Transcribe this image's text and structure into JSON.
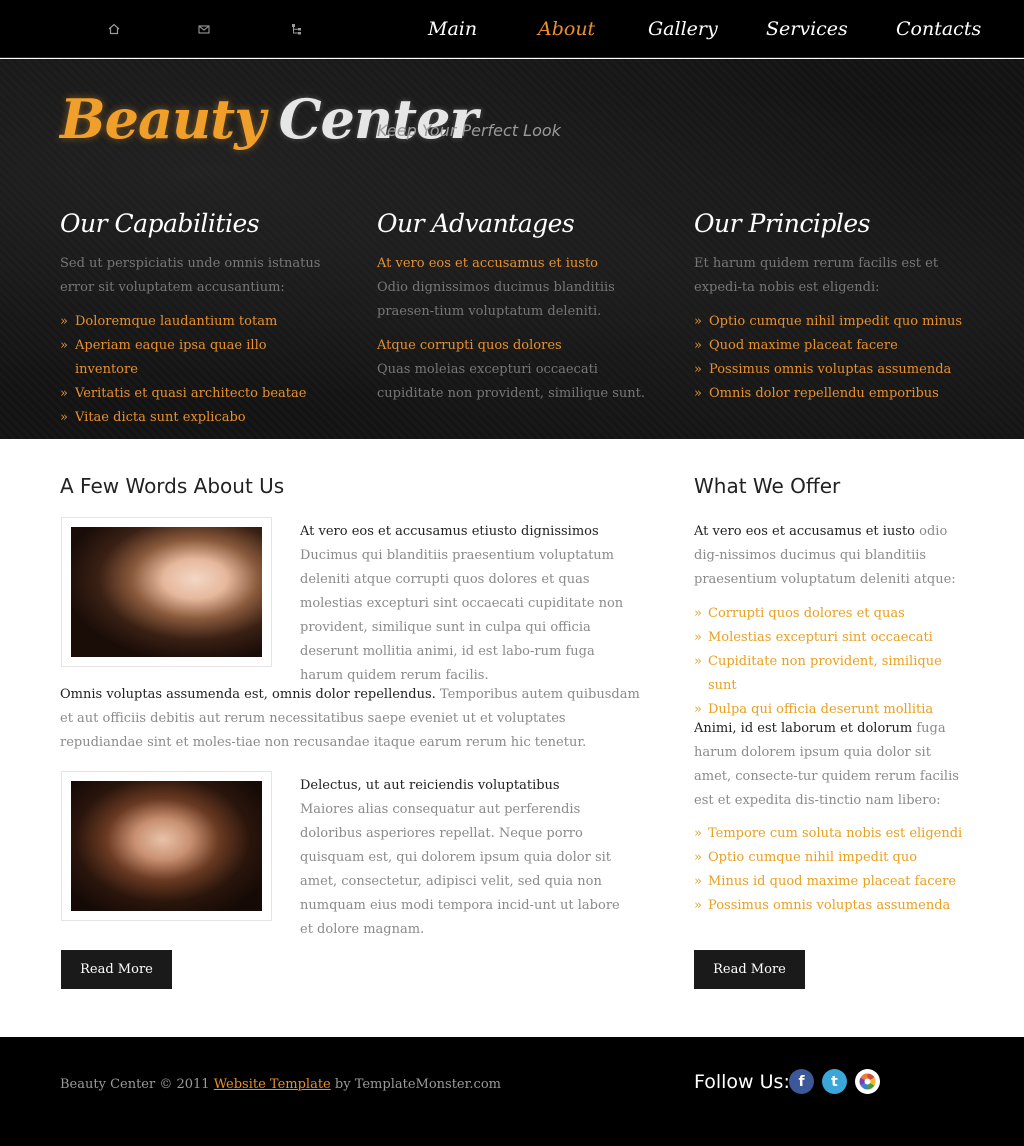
{
  "nav": {
    "items": [
      {
        "label": "Main"
      },
      {
        "label": "About",
        "active": true
      },
      {
        "label": "Gallery"
      },
      {
        "label": "Services"
      },
      {
        "label": "Contacts"
      }
    ],
    "active_color": "#e8902e",
    "util_icons": [
      "home-icon",
      "mail-icon",
      "sitemap-icon"
    ]
  },
  "hero": {
    "logo_word1": "Beauty",
    "logo_word2": "Center",
    "tagline": "Keep Your Perfect Look",
    "accent_color": "#f0a02a",
    "columns": [
      {
        "title": "Our Capabilities",
        "intro": "Sed ut perspiciatis unde omnis istnatus error sit voluptatem accusantium:",
        "items": [
          "Doloremque laudantium totam",
          "Aperiam eaque ipsa quae illo inventore",
          "Veritatis et quasi architecto beatae",
          "Vitae dicta sunt explicabo"
        ]
      },
      {
        "title": "Our Advantages",
        "block1_lead": "At vero eos et accusamus et iusto",
        "block1_text": "Odio dignissimos ducimus blanditiis praesen-tium voluptatum deleniti.",
        "block2_lead": "Atque corrupti quos dolores",
        "block2_text": "Quas moleias excepturi occaecati cupiditate non provident, similique sunt."
      },
      {
        "title": "Our Principles",
        "intro": "Et harum quidem rerum facilis est et expedi-ta nobis est eligendi:",
        "items": [
          "Optio cumque nihil impedit quo minus",
          "Quod maxime placeat facere",
          "Possimus omnis voluptas assumenda",
          "Omnis dolor repellendu emporibus"
        ]
      }
    ]
  },
  "about": {
    "title": "A Few Words About Us",
    "block1_head": "At vero eos et accusamus etiusto dignissimos",
    "block1_text": "Ducimus qui blanditiis praesentium voluptatum deleniti atque corrupti quos dolores et quas molestias excepturi sint occaecati cupiditate non provident, similique sunt in culpa qui officia deserunt mollitia animi, id est labo-rum fuga harum quidem rerum facilis.",
    "para_head": "Omnis voluptas assumenda est, omnis dolor repellendus.",
    "para_text": "Temporibus autem quibusdam et aut officiis debitis aut rerum necessitatibus saepe eveniet ut et voluptates repudiandae sint et moles-tiae non recusandae itaque earum rerum hic tenetur.",
    "block2_head": "Delectus, ut aut reiciendis voluptatibus",
    "block2_text": "Maiores alias consequatur aut perferendis doloribus asperiores repellat. Neque porro quisquam est, qui dolorem ipsum quia dolor sit amet, consectetur, adipisci velit, sed quia non numquam eius modi tempora incid-unt ut labore et dolore magnam.",
    "button": "Read More"
  },
  "offer": {
    "title": "What We Offer",
    "p1_head": "At vero eos et accusamus et iusto",
    "p1_text": "odio dig-nissimos ducimus qui blanditiis praesentium voluptatum deleniti atque:",
    "list1": [
      "Corrupti quos dolores et quas",
      "Molestias excepturi sint occaecati",
      "Cupiditate non provident, similique sunt",
      "Dulpa qui officia deserunt mollitia"
    ],
    "p2_head": "Animi, id est laborum et dolorum",
    "p2_text": "fuga harum dolorem ipsum quia dolor sit amet, consecte-tur quidem rerum facilis est et expedita dis-tinctio nam libero:",
    "list2": [
      "Tempore cum soluta nobis est eligendi",
      "Optio cumque nihil impedit quo",
      "Minus id quod maxime placeat facere",
      "Possimus omnis voluptas assumenda"
    ],
    "button": "Read More",
    "list_color": "#e8a020"
  },
  "footer": {
    "copy_prefix": "Beauty Center © 2011",
    "link": "Website Template",
    "copy_suffix": "by TemplateMonster.com",
    "follow": "Follow Us:",
    "social": [
      {
        "icon": "facebook-icon",
        "glyph": "f",
        "color": "#3b5998"
      },
      {
        "icon": "twitter-icon",
        "glyph": "t",
        "color": "#3ba6d8"
      },
      {
        "icon": "picasa-icon",
        "glyph": "◉",
        "color": "#ffffff"
      }
    ]
  }
}
